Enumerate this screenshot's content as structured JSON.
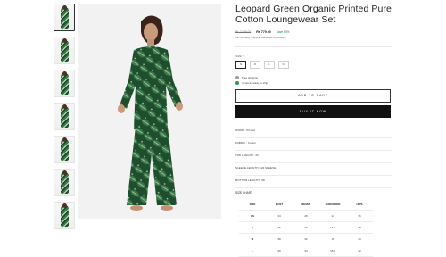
{
  "product": {
    "title": "Leopard Green Organic Printed Pure Cotton Loungewear Set",
    "mrp": "Rs 2,099.00",
    "price": "Rs 779.00",
    "saving": "Save 63%",
    "tax_note": "Tax included. Shipping calculated at checkout."
  },
  "size_selector": {
    "label": "SIZE: S",
    "options": [
      "S",
      "M",
      "L",
      "XL"
    ],
    "selected": "S"
  },
  "availability": {
    "shipping": "Free shipping",
    "stock": "In stock, ready to ship"
  },
  "actions": {
    "add_to_cart": "ADD TO CART",
    "buy_now": "BUY IT NOW"
  },
  "details": [
    "WORK : Printed",
    "FABRIC : Cotton",
    "TOP LENGTH : 33",
    "SLEEVE LENGTH : 3/4 SLEEVE",
    "BOTTOM LENGTH : 38"
  ],
  "size_chart": {
    "title": "SIZE CHART",
    "headers": [
      "SIZE",
      "BUST",
      "WAIST",
      "SHOULDER",
      "HIPS"
    ],
    "rows": [
      [
        "XS",
        "34",
        "28",
        "14",
        "36"
      ],
      [
        "S",
        "36",
        "30",
        "14.5",
        "38"
      ],
      [
        "M",
        "38",
        "32",
        "15",
        "40"
      ],
      [
        "L",
        "40",
        "34",
        "15.5",
        "42"
      ]
    ]
  },
  "colors": {
    "accent": "#111111",
    "stock_dot": "#2e9a4b",
    "print_dark": "#1f4e2f",
    "print_mid": "#3d7a4a"
  },
  "icons": {
    "shipping": "truck-icon",
    "stock": "in-stock-dot-icon"
  }
}
